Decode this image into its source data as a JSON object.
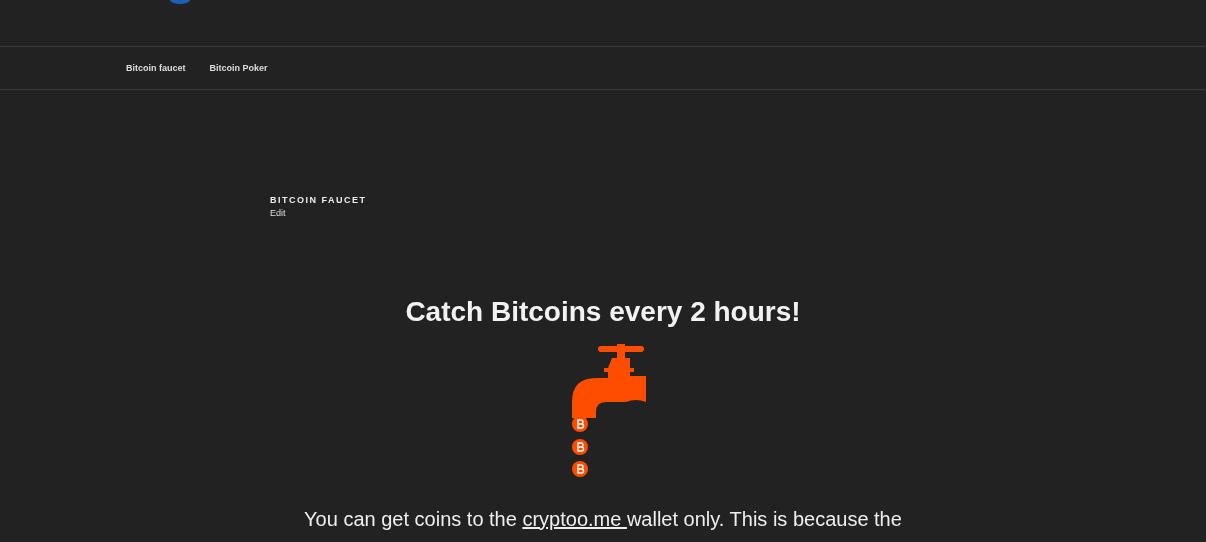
{
  "nav": {
    "items": [
      {
        "label": "Bitcoin faucet"
      },
      {
        "label": "Bitcoin Poker"
      }
    ]
  },
  "page": {
    "title": "BITCOIN FAUCET",
    "edit_link": "Edit"
  },
  "content": {
    "heading": "Catch Bitcoins every 2 hours!",
    "intro": {
      "before": "You can get coins to the ",
      "link": "cryptoo.me ",
      "after": " wallet only. This is because the"
    }
  }
}
